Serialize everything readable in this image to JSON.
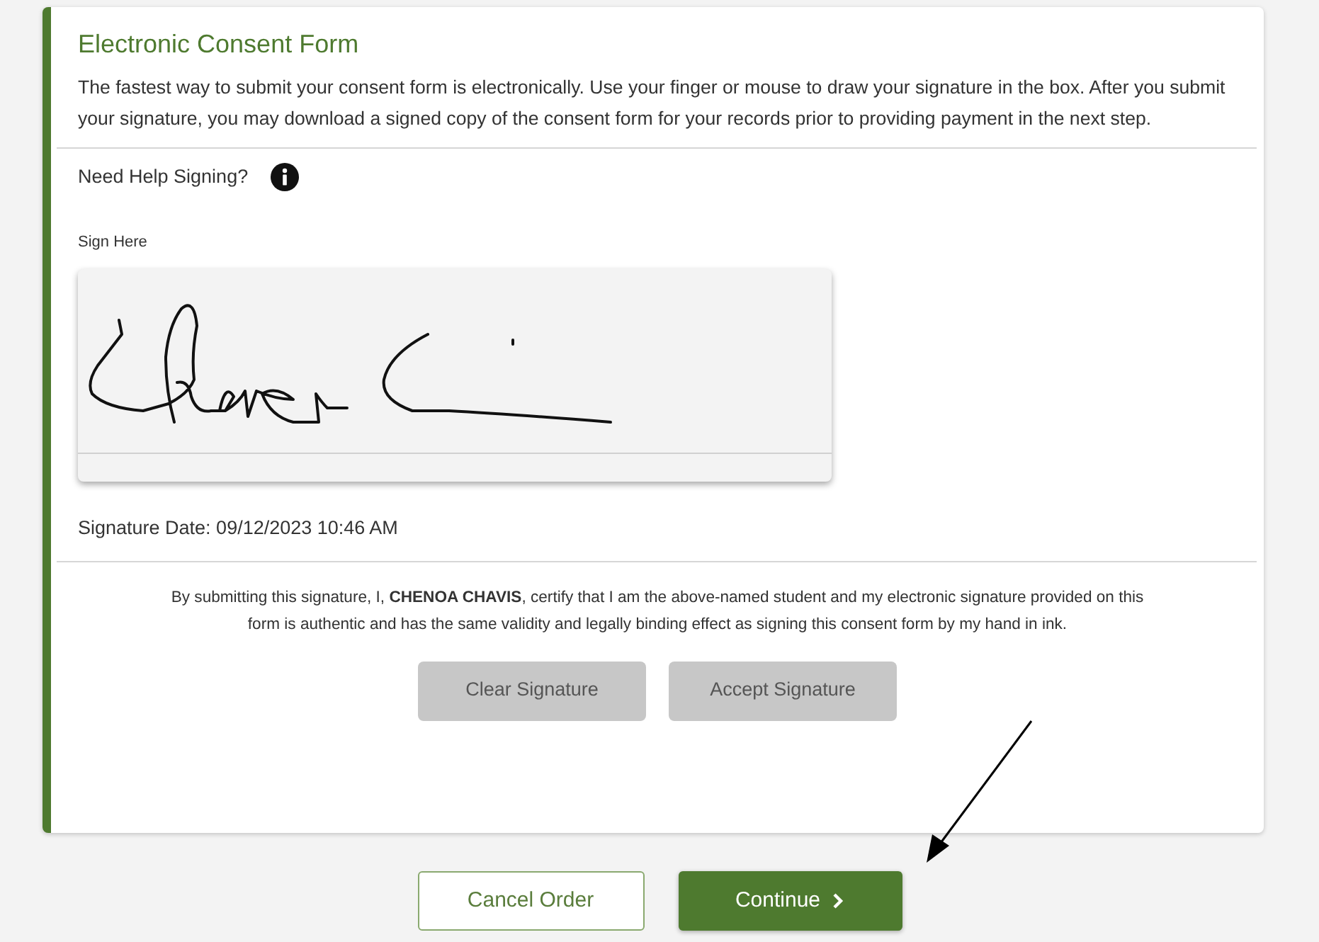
{
  "form": {
    "title": "Electronic Consent Form",
    "intro": "The fastest way to submit your consent form is electronically. Use your finger or mouse to draw your signature in the box. After you submit your signature, you may download a signed copy of the consent form for your records prior to providing payment in the next step.",
    "help_label": "Need Help Signing?",
    "sign_label": "Sign Here",
    "signature_date": "Signature Date: 09/12/2023 10:46 AM",
    "certification": "By submitting this signature, I, **CHENOA CHAVIS**, certify that I am the above-named student and my electronic signature provided on this form is authentic and has the same validity and legally binding effect as signing this consent form by my hand in ink.",
    "buttons": [
      {
        "label": "Clear Signature",
        "disabled": true
      },
      {
        "label": "Accept Signature",
        "disabled": true
      }
    ]
  },
  "footer_buttons": [
    {
      "label": "Cancel Order",
      "kind": "outline"
    },
    {
      "label": "Continue",
      "kind": "primary"
    }
  ]
}
